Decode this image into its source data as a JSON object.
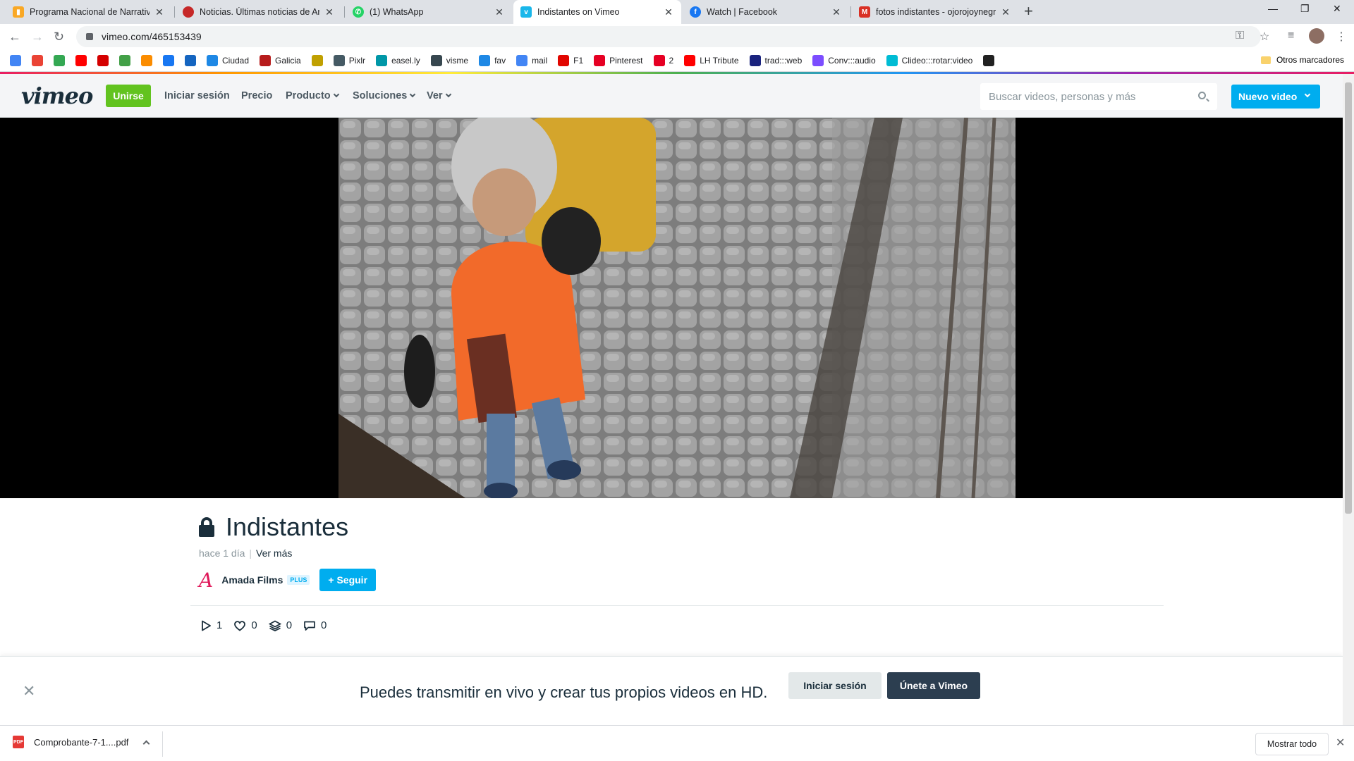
{
  "browser": {
    "tabs": [
      {
        "title": "Programa Nacional de Narrativas",
        "icon": "bookmark-orange-icon",
        "color": "#f9a825"
      },
      {
        "title": "Noticias. Últimas noticias de Arge",
        "icon": "news-red-icon",
        "color": "#c62828"
      },
      {
        "title": "(1) WhatsApp",
        "icon": "whatsapp-icon",
        "color": "#25d366"
      },
      {
        "title": "Indistantes on Vimeo",
        "icon": "vimeo-icon",
        "color": "#1ab7ea"
      },
      {
        "title": "Watch | Facebook",
        "icon": "facebook-icon",
        "color": "#1877f2"
      },
      {
        "title": "fotos indistantes - ojorojoynegro",
        "icon": "gmail-icon",
        "color": "#d93025"
      }
    ],
    "url": "vimeo.com/465153439",
    "bookmarks": [
      {
        "label": "",
        "icon": "google-icon",
        "color": "#4285f4"
      },
      {
        "label": "",
        "icon": "apps-icon",
        "color": "#ea4335"
      },
      {
        "label": "",
        "icon": "maps-icon",
        "color": "#34a853"
      },
      {
        "label": "",
        "icon": "youtube-icon",
        "color": "#ff0000"
      },
      {
        "label": "",
        "icon": "red-logo-icon",
        "color": "#d50000"
      },
      {
        "label": "",
        "icon": "green-logo-icon",
        "color": "#43a047"
      },
      {
        "label": "",
        "icon": "orange-logo-icon",
        "color": "#fb8c00"
      },
      {
        "label": "",
        "icon": "facebook-icon",
        "color": "#1877f2"
      },
      {
        "label": "",
        "icon": "news-icon",
        "color": "#1565c0"
      },
      {
        "label": "Ciudad",
        "icon": "ciudad-icon",
        "color": "#1e88e5"
      },
      {
        "label": "Galicia",
        "icon": "galicia-icon",
        "color": "#b71c1c"
      },
      {
        "label": "",
        "icon": "yellow-logo-icon",
        "color": "#c0a000"
      },
      {
        "label": "Pixlr",
        "icon": "pixlr-icon",
        "color": "#455a64"
      },
      {
        "label": "easel.ly",
        "icon": "easelly-icon",
        "color": "#0097a7"
      },
      {
        "label": "visme",
        "icon": "visme-icon",
        "color": "#37474f"
      },
      {
        "label": "fav",
        "icon": "star-icon",
        "color": "#1e88e5"
      },
      {
        "label": "mail",
        "icon": "google-mail-icon",
        "color": "#4285f4"
      },
      {
        "label": "F1",
        "icon": "f1-icon",
        "color": "#e10600"
      },
      {
        "label": "Pinterest",
        "icon": "pinterest-icon",
        "color": "#e60023"
      },
      {
        "label": "2",
        "icon": "pinterest-2-icon",
        "color": "#e60023"
      },
      {
        "label": "LH Tribute",
        "icon": "youtube-icon",
        "color": "#ff0000"
      },
      {
        "label": "trad:::web",
        "icon": "translate-icon",
        "color": "#1a237e"
      },
      {
        "label": "Conv:::audio",
        "icon": "audio-convert-icon",
        "color": "#7c4dff"
      },
      {
        "label": "Clideo:::rotar:video",
        "icon": "clideo-icon",
        "color": "#00bcd4"
      },
      {
        "label": "",
        "icon": "bolt-icon",
        "color": "#212121"
      }
    ],
    "other_bookmarks": "Otros marcadores"
  },
  "vimeo": {
    "logo": "vimeo",
    "join": "Unirse",
    "nav": [
      "Iniciar sesión",
      "Precio",
      "Producto",
      "Soluciones",
      "Ver"
    ],
    "search_placeholder": "Buscar videos, personas y más",
    "new_video": "Nuevo video",
    "video": {
      "title": "Indistantes",
      "age": "hace 1 día",
      "see_more": "Ver más",
      "owner": "Amada Films",
      "owner_badge": "PLUS",
      "follow": "+ Seguir",
      "stats": {
        "plays": "1",
        "likes": "0",
        "collections": "0",
        "comments": "0"
      }
    },
    "banner": {
      "text": "Puedes transmitir en vivo y crear tus propios videos en HD.",
      "login": "Iniciar sesión",
      "join": "Únete a Vimeo"
    },
    "colors": {
      "brand_green": "#62c31f",
      "brand_blue": "#00adef",
      "dark": "#1a2e3b"
    }
  },
  "downloads": {
    "file": "Comprobante-7-1....pdf",
    "file_type": "PDF",
    "show_all": "Mostrar todo"
  }
}
